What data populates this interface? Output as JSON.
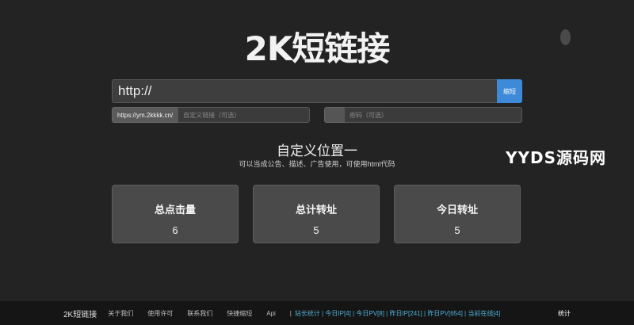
{
  "header": {
    "title": "2K短链接"
  },
  "form": {
    "url_value": "http://",
    "shorten_label": "缩短",
    "prefix": "https://ym.2kkkk.cn/",
    "custom_placeholder": "自定义链接（可选）",
    "password_placeholder": "密码（可选）"
  },
  "custom_position": {
    "title": "自定义位置一",
    "desc": "可以当成公告、描述、广告使用，可使用html代码"
  },
  "watermark": "YYDS源码网",
  "stats_cards": [
    {
      "label": "总点击量",
      "value": "6"
    },
    {
      "label": "总计转址",
      "value": "5"
    },
    {
      "label": "今日转址",
      "value": "5"
    }
  ],
  "footer": {
    "brand": "2K短链接",
    "links": [
      "关于我们",
      "使用许可",
      "联系我们",
      "快捷缩短",
      "Api"
    ],
    "separator": "|",
    "stats_text": "站长统计 | 今日IP[4] | 今日PV[8] | 昨日IP[241] | 昨日PV[654] | 当前在线[4]",
    "stats_button": "统计"
  },
  "colors": {
    "accent": "#3d8bd8",
    "background": "#232323",
    "stats_link": "#4fb0d8"
  }
}
